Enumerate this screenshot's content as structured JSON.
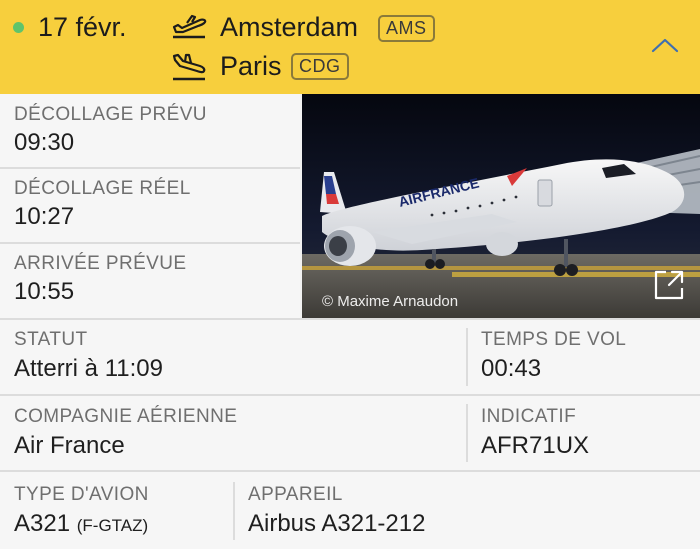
{
  "header": {
    "date": "17 févr.",
    "departure_city": "Amsterdam",
    "departure_code": "AMS",
    "arrival_city": "Paris",
    "arrival_code": "CDG",
    "status_color": "#5fc46b",
    "background_color": "#f7cf3d",
    "icons": [
      "takeoff-icon",
      "landing-icon",
      "chevron-up-icon"
    ]
  },
  "times": {
    "scheduled_departure_label": "DÉCOLLAGE PRÉVU",
    "scheduled_departure_value": "09:30",
    "actual_departure_label": "DÉCOLLAGE RÉEL",
    "actual_departure_value": "10:27",
    "scheduled_arrival_label": "ARRIVÉE PRÉVUE",
    "scheduled_arrival_value": "10:55"
  },
  "photo": {
    "credit": "© Maxime Arnaudon",
    "airline_livery": "AIRFRANCE",
    "icons": [
      "expand-icon"
    ]
  },
  "details": {
    "status_label": "STATUT",
    "status_value": "Atterri à 11:09",
    "flight_time_label": "TEMPS DE VOL",
    "flight_time_value": "00:43",
    "airline_label": "COMPAGNIE AÉRIENNE",
    "airline_value": "Air France",
    "callsign_label": "INDICATIF",
    "callsign_value": "AFR71UX",
    "aircraft_type_label": "TYPE D'AVION",
    "aircraft_type_value": "A321",
    "registration_value": "(F-GTAZ)",
    "aircraft_label": "APPAREIL",
    "aircraft_value": "Airbus A321-212"
  }
}
